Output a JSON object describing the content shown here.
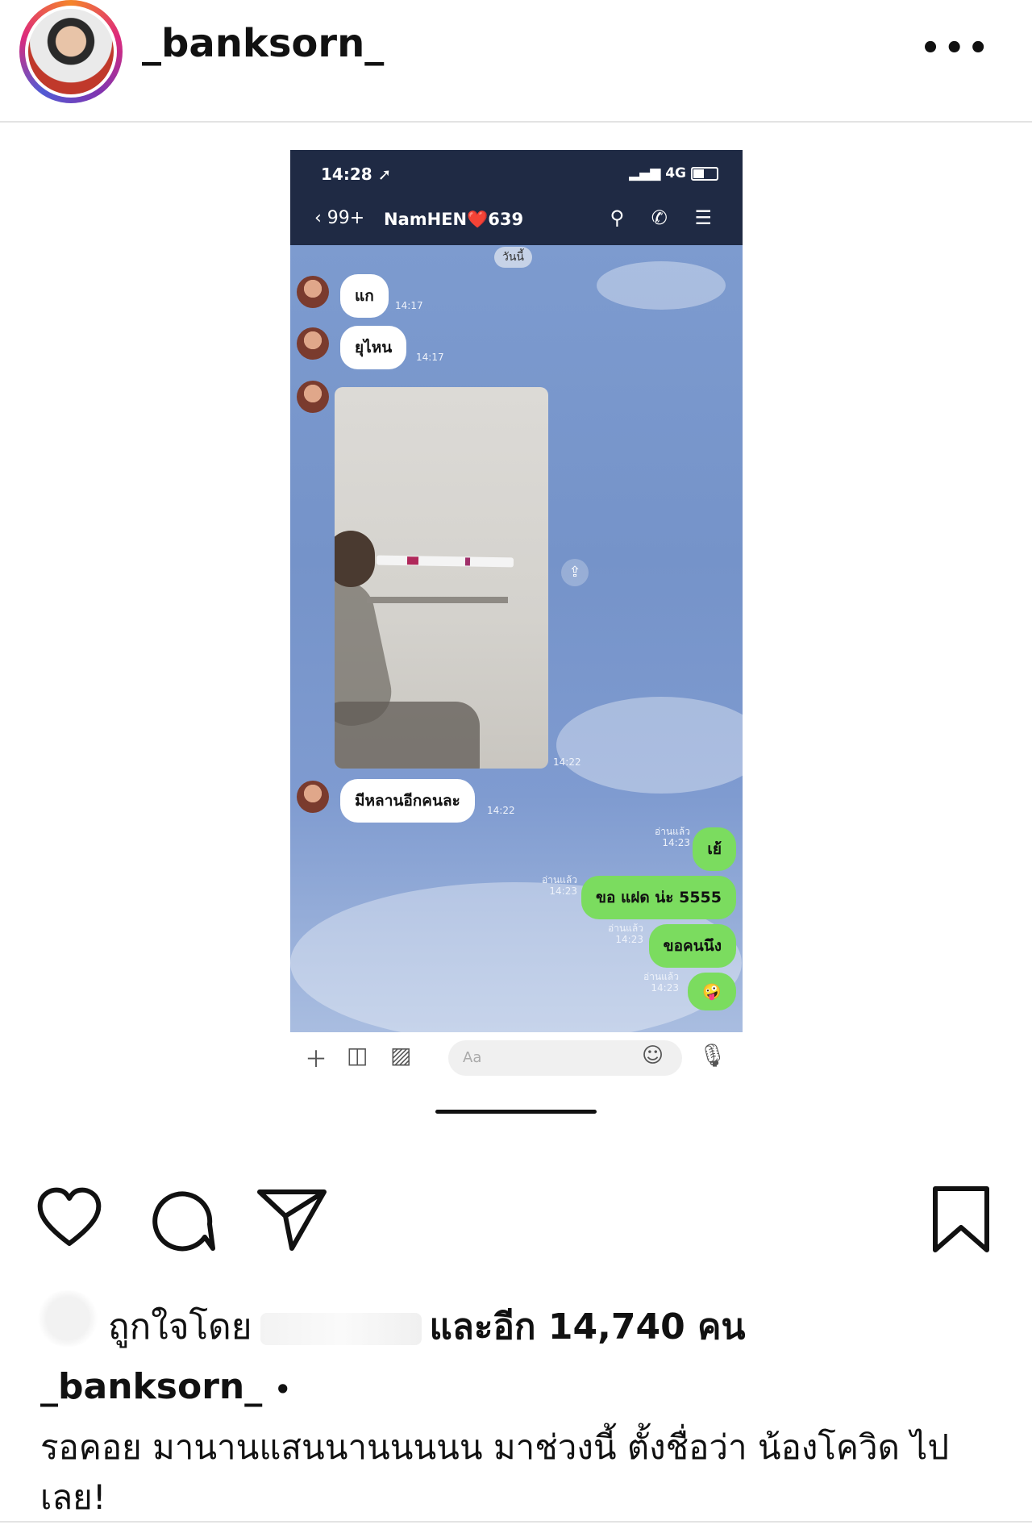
{
  "header": {
    "username": "_banksorn_",
    "more_label": "•••"
  },
  "screenshot": {
    "status": {
      "time": "14:28",
      "network": "4G"
    },
    "chat_header": {
      "back_count": "99+",
      "contact_name": "NamHEN",
      "heart": "❤️",
      "contact_suffix": "639"
    },
    "date_chip": "วันนี้",
    "messages": [
      {
        "from": "them",
        "text": "แก",
        "time": "14:17"
      },
      {
        "from": "them",
        "text": "ยุไหน",
        "time": "14:17"
      },
      {
        "from": "them",
        "type": "photo",
        "time": "14:22"
      },
      {
        "from": "them",
        "text": "มีหลานอีกคนละ",
        "time": "14:22"
      },
      {
        "from": "me",
        "text": "เย้",
        "read": "อ่านแล้ว",
        "time": "14:23"
      },
      {
        "from": "me",
        "text": "ขอ แฝด น่ะ 5555",
        "read": "อ่านแล้ว",
        "time": "14:23"
      },
      {
        "from": "me",
        "text": "ขอคนนึง",
        "read": "อ่านแล้ว",
        "time": "14:23"
      },
      {
        "from": "me",
        "text": "🤪",
        "read": "อ่านแล้ว",
        "time": "14:23"
      }
    ],
    "input_placeholder": "Aa"
  },
  "actions": {
    "icons": [
      "heart-icon",
      "comment-icon",
      "share-icon",
      "bookmark-icon"
    ]
  },
  "likes": {
    "prefix": "ถูกใจโดย",
    "count_text": "และอีก 14,740 คน"
  },
  "caption": {
    "username": "_banksorn_",
    "dot": "•",
    "text": "รอคอย มานานแสนนานนนนน มาช่วงนี้ ตั้งชื่อว่า น้องโควิด ไปเลย!"
  }
}
